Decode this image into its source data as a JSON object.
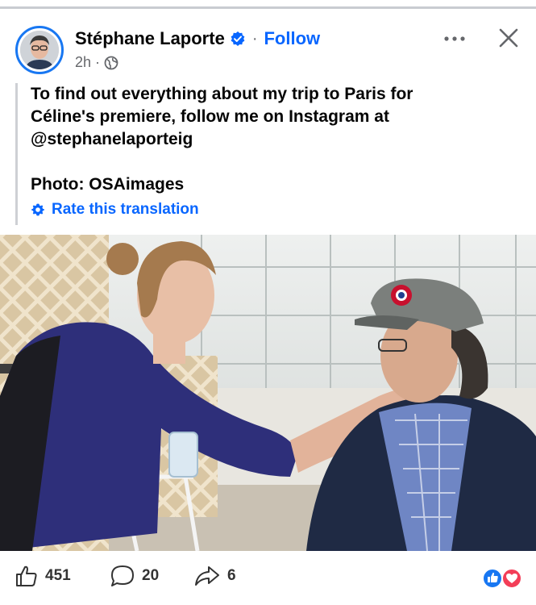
{
  "header": {
    "author_name": "Stéphane Laporte",
    "separator": "·",
    "follow_label": "Follow",
    "time": "2h",
    "meta_separator": "·",
    "audience_icon": "globe-icon",
    "more_icon": "more-horizontal-icon",
    "close_icon": "close-icon",
    "verified_icon": "verified-badge-icon",
    "accent_color": "#0866ff"
  },
  "post": {
    "lines": [
      "To find out everything about my trip to Paris for",
      "Céline's premiere, follow me on Instagram at",
      "@stephanelaporteig"
    ],
    "photo_credit": "Photo: OSAimages",
    "rate_translation_label": "Rate this translation",
    "rate_icon": "gear-icon"
  },
  "photo": {
    "icon": "photo-image"
  },
  "actions": {
    "like_count": "451",
    "comment_count": "20",
    "share_count": "6",
    "like_icon": "thumbs-up-icon",
    "comment_icon": "comment-bubble-icon",
    "share_icon": "share-arrow-icon",
    "reaction_icons": [
      "like-reaction-icon",
      "love-reaction-icon"
    ]
  }
}
